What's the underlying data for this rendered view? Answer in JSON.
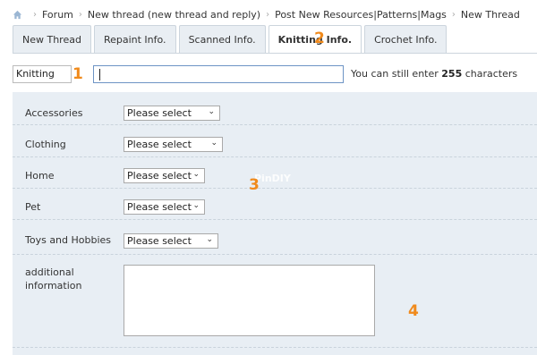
{
  "breadcrumb": {
    "items": [
      "Forum",
      "New thread (new thread and reply)",
      "Post New Resources|Patterns|Mags",
      "New Thread"
    ]
  },
  "tabs": [
    {
      "label": "New Thread",
      "active": false
    },
    {
      "label": "Repaint Info.",
      "active": false
    },
    {
      "label": "Scanned Info.",
      "active": false
    },
    {
      "label": "Knitting Info.",
      "active": true
    },
    {
      "label": "Crochet Info.",
      "active": false
    }
  ],
  "title_row": {
    "prefix_value": "Knitting",
    "title_value": "",
    "char_note_prefix": "You can still enter",
    "char_count": "255",
    "char_note_suffix": "characters"
  },
  "form": {
    "rows": [
      {
        "label": "Accessories",
        "value": "Please select"
      },
      {
        "label": "Clothing",
        "value": "Please select"
      },
      {
        "label": "Home",
        "value": "Please select"
      },
      {
        "label": "Pet",
        "value": "Please select"
      },
      {
        "label": "Toys and Hobbies",
        "value": "Please select"
      }
    ],
    "additional_label_line1": "additional",
    "additional_label_line2": "information",
    "watermark": "PinDIY"
  },
  "annotations": [
    "1",
    "2",
    "3",
    "4"
  ],
  "colors": {
    "annotation": "#f08a1c",
    "panel": "#e8eef4",
    "input_border_focus": "#6d94c5"
  }
}
